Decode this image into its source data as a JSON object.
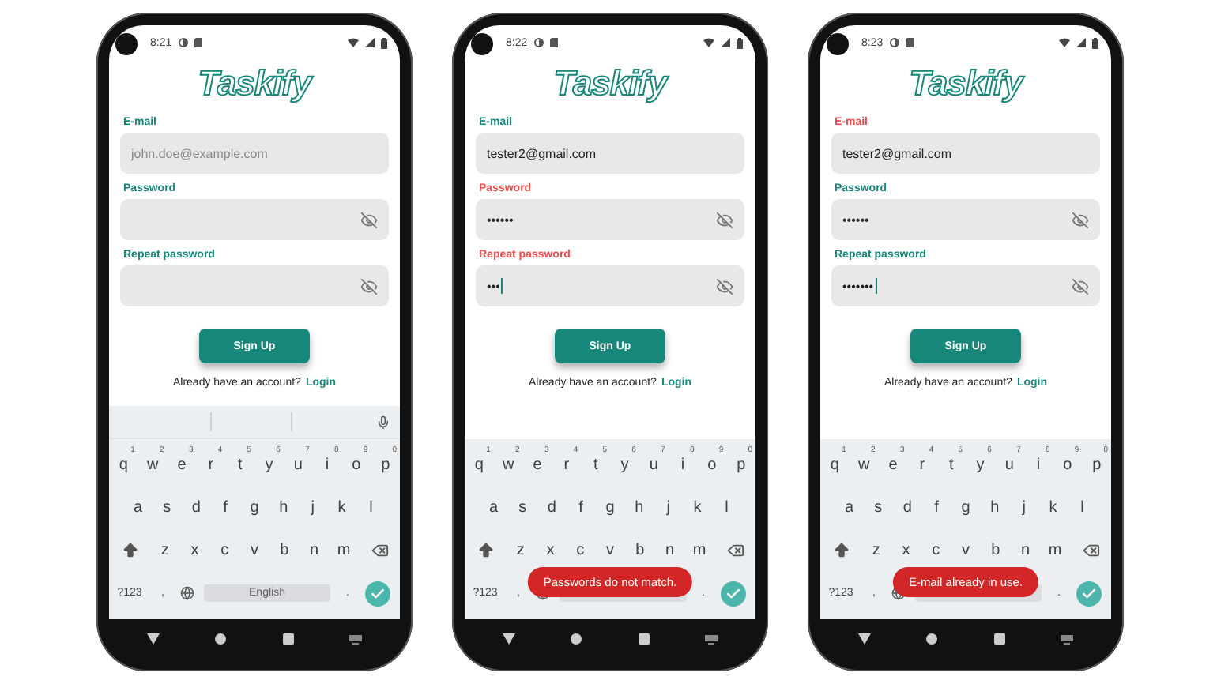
{
  "phones": [
    {
      "status_time": "8:21",
      "logo": "Taskify",
      "fields": [
        {
          "kind": "text",
          "label": "E-mail",
          "placeholder": "john.doe@example.com",
          "error": false,
          "focused": false
        },
        {
          "kind": "password",
          "label": "Password",
          "error": false,
          "focused": false
        },
        {
          "kind": "password",
          "label": "Repeat password",
          "error": false,
          "focused": false
        }
      ],
      "button": "Sign Up",
      "footer": {
        "text": "Already have an account?",
        "link": "Login"
      },
      "keyboard": {
        "suggestions": true,
        "hints": [
          "1",
          "2",
          "3",
          "4",
          "5",
          "6",
          "7",
          "8",
          "9",
          "0"
        ],
        "rows": [
          [
            "q",
            "w",
            "e",
            "r",
            "t",
            "y",
            "u",
            "i",
            "o",
            "p"
          ],
          [
            "a",
            "s",
            "d",
            "f",
            "g",
            "h",
            "j",
            "k",
            "l"
          ],
          [
            "z",
            "x",
            "c",
            "v",
            "b",
            "n",
            "m"
          ]
        ],
        "symbols_key": "?123",
        "comma": ",",
        "period": ".",
        "space_label": "English"
      }
    },
    {
      "status_time": "8:22",
      "logo": "Taskify",
      "fields": [
        {
          "kind": "text",
          "label": "E-mail",
          "value": "tester2@gmail.com",
          "error": false,
          "focused": false
        },
        {
          "kind": "password",
          "label": "Password",
          "value": "••••••",
          "error": true,
          "focused": false
        },
        {
          "kind": "password",
          "label": "Repeat password",
          "value": "•••",
          "error": true,
          "focused": true
        }
      ],
      "button": "Sign Up",
      "footer": {
        "text": "Already have an account?",
        "link": "Login"
      },
      "keyboard": {
        "suggestions": false,
        "hints": [
          "1",
          "2",
          "3",
          "4",
          "5",
          "6",
          "7",
          "8",
          "9",
          "0"
        ],
        "rows": [
          [
            "q",
            "w",
            "e",
            "r",
            "t",
            "y",
            "u",
            "i",
            "o",
            "p"
          ],
          [
            "a",
            "s",
            "d",
            "f",
            "g",
            "h",
            "j",
            "k",
            "l"
          ],
          [
            "z",
            "x",
            "c",
            "v",
            "b",
            "n",
            "m"
          ]
        ],
        "symbols_key": "?123",
        "comma": ",",
        "period": "."
      },
      "toast": "Passwords do not match."
    },
    {
      "status_time": "8:23",
      "logo": "Taskify",
      "fields": [
        {
          "kind": "text",
          "label": "E-mail",
          "value": "tester2@gmail.com",
          "error": true,
          "focused": false
        },
        {
          "kind": "password",
          "label": "Password",
          "value": "••••••",
          "error": false,
          "focused": false
        },
        {
          "kind": "password",
          "label": "Repeat password",
          "value": "•••••••",
          "error": false,
          "focused": true
        }
      ],
      "button": "Sign Up",
      "footer": {
        "text": "Already have an account?",
        "link": "Login"
      },
      "keyboard": {
        "suggestions": false,
        "hints": [
          "1",
          "2",
          "3",
          "4",
          "5",
          "6",
          "7",
          "8",
          "9",
          "0"
        ],
        "rows": [
          [
            "q",
            "w",
            "e",
            "r",
            "t",
            "y",
            "u",
            "i",
            "o",
            "p"
          ],
          [
            "a",
            "s",
            "d",
            "f",
            "g",
            "h",
            "j",
            "k",
            "l"
          ],
          [
            "z",
            "x",
            "c",
            "v",
            "b",
            "n",
            "m"
          ]
        ],
        "symbols_key": "?123",
        "comma": ",",
        "period": "."
      },
      "toast": "E-mail already in use."
    }
  ]
}
